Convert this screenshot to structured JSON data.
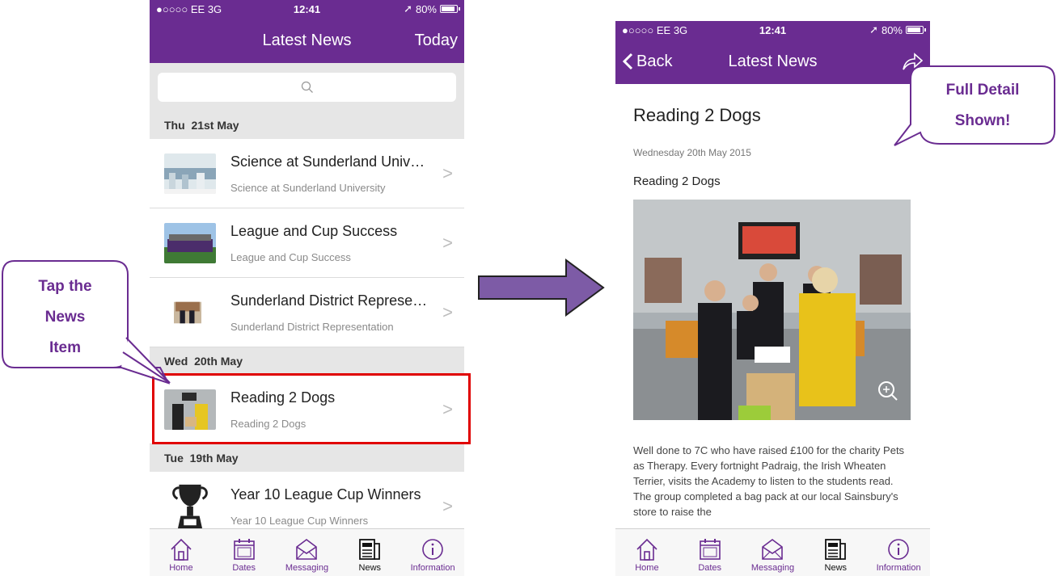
{
  "status": {
    "signal": "●○○○○ EE  3G",
    "time": "12:41",
    "battery": "80%"
  },
  "left": {
    "title": "Latest News",
    "today": "Today",
    "sections": [
      {
        "day": "Thu",
        "date": "21st May"
      },
      {
        "day": "Wed",
        "date": "20th May"
      },
      {
        "day": "Tue",
        "date": "19th May"
      }
    ],
    "items": [
      {
        "title": "Science at Sunderland Univ…",
        "subtitle": "Science at Sunderland University"
      },
      {
        "title": "League and Cup Success",
        "subtitle": "League and Cup Success"
      },
      {
        "title": "Sunderland District Represe…",
        "subtitle": "Sunderland District Representation"
      },
      {
        "title": "Reading 2 Dogs",
        "subtitle": "Reading 2 Dogs"
      },
      {
        "title": "Year 10 League Cup Winners",
        "subtitle": "Year 10 League Cup Winners"
      }
    ]
  },
  "right": {
    "back": "Back",
    "title": "Latest News",
    "article_title": "Reading 2 Dogs",
    "article_date": "Wednesday 20th May 2015",
    "article_sub": "Reading 2 Dogs",
    "body": "Well done to 7C who have raised £100 for the charity Pets as Therapy.  Every fortnight Padraig, the Irish Wheaten Terrier, visits the Academy to listen to the students read.  The group completed a bag pack at our local Sainsbury's store to raise the"
  },
  "tabs": [
    "Home",
    "Dates",
    "Messaging",
    "News",
    "Information"
  ],
  "callouts": {
    "tap_line1": "Tap the",
    "tap_line2": "News",
    "tap_line3": "Item",
    "full_line1": "Full Detail",
    "full_line2": "Shown!"
  },
  "colors": {
    "brand": "#6a2c91",
    "highlight": "#e00000",
    "arrow": "#7d5ba6"
  }
}
